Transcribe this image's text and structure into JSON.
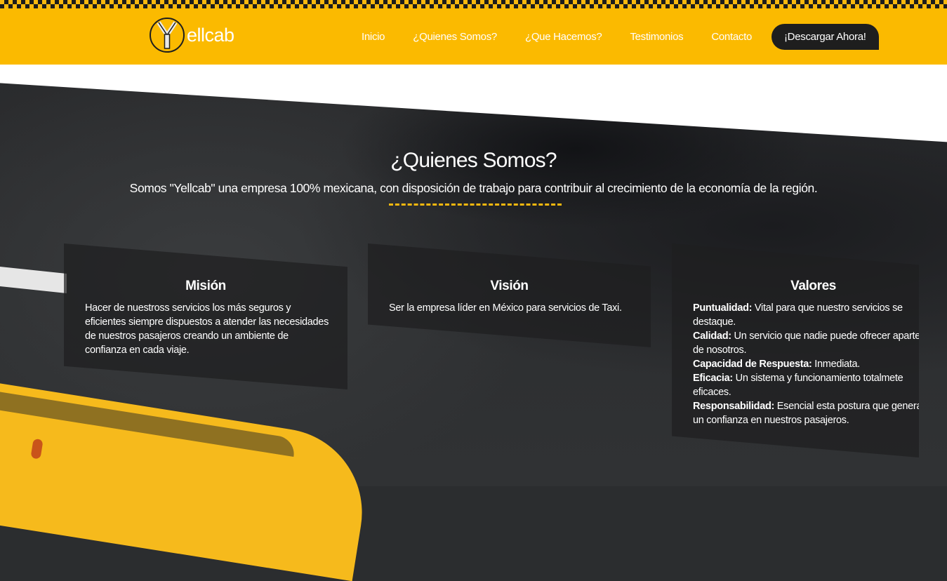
{
  "brand": {
    "logo_letter": "Y",
    "logo_text": "ellcab"
  },
  "nav": {
    "items": [
      "Inicio",
      "¿Quienes Somos?",
      "¿Que Hacemos?",
      "Testimonios",
      "Contacto"
    ],
    "cta": "¡Descargar Ahora!"
  },
  "about": {
    "title": "¿Quienes Somos?",
    "subtitle": "Somos \"Yellcab\" una empresa 100% mexicana, con disposición de trabajo para contribuir al crecimiento de la economía de la región."
  },
  "cards": {
    "mision": {
      "title": "Misión",
      "text": "Hacer de nuestross servicios los más seguros y eficientes siempre dispuestos a atender las necesidades de nuestros pasajeros creando un ambiente de confianza en cada viaje."
    },
    "vision": {
      "title": "Visión",
      "text": "Ser la empresa líder en México para servicios de Taxi."
    },
    "valores": {
      "title": "Valores",
      "items": [
        {
          "label": "Puntualidad:",
          "text": " Vital para que nuestro servicios se destaque."
        },
        {
          "label": "Calidad:",
          "text": " Un servicio que nadie puede ofrecer aparte de nosotros."
        },
        {
          "label": "Capacidad de Respuesta:",
          "text": " Inmediata."
        },
        {
          "label": "Eficacia:",
          "text": " Un sistema y funcionamiento totalmete eficaces."
        },
        {
          "label": "Responsabilidad:",
          "text": " Esencial esta postura que genera un confianza en nuestros pasajeros."
        }
      ]
    }
  },
  "colors": {
    "brand_yellow": "#fbba00",
    "dark": "#1e1e1e",
    "dash": "#f8b80e"
  },
  "icons": {
    "logo": "y-circle-logo-icon"
  }
}
